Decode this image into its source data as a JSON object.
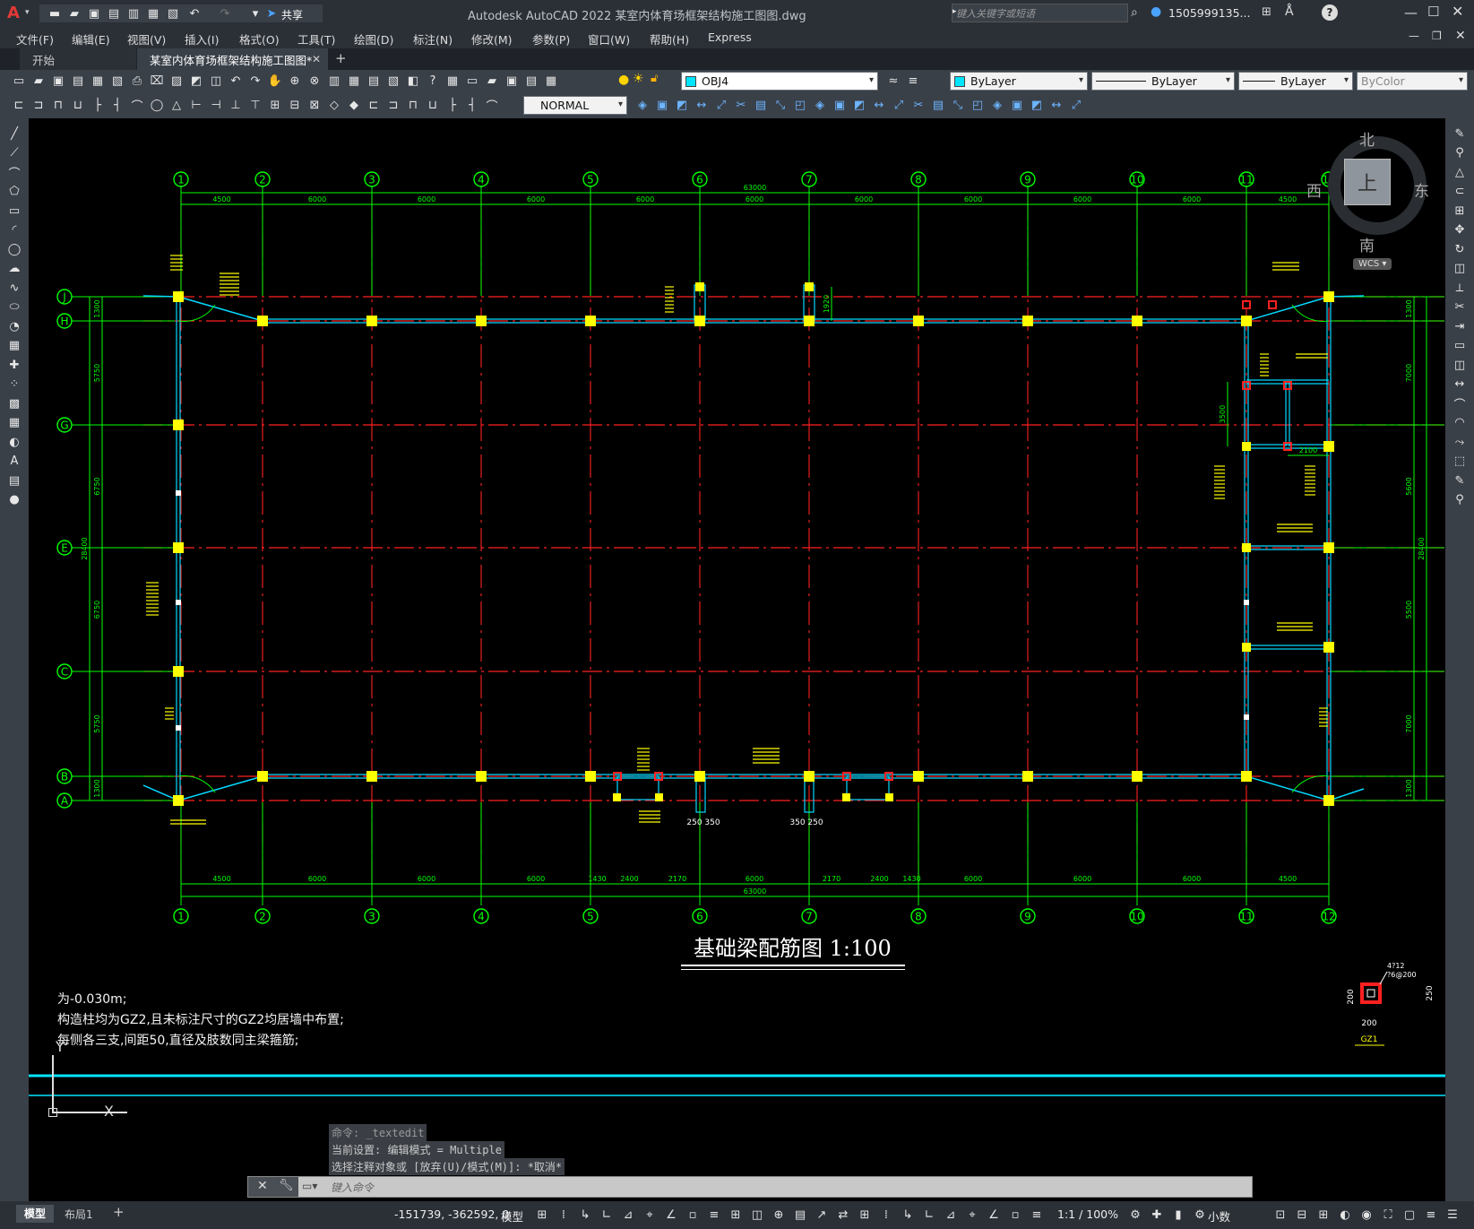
{
  "titlebar": {
    "app_letter": "A",
    "share": "共享",
    "title": "Autodesk AutoCAD 2022    某室内体育场框架结构施工图图.dwg",
    "search_placeholder": "键入关键字或短语",
    "user": "1505999135...",
    "help": "?"
  },
  "menu": [
    "文件(F)",
    "编辑(E)",
    "视图(V)",
    "插入(I)",
    "格式(O)",
    "工具(T)",
    "绘图(D)",
    "标注(N)",
    "修改(M)",
    "参数(P)",
    "窗口(W)",
    "帮助(H)",
    "Express"
  ],
  "tabs": {
    "start": "开始",
    "active": "某室内体育场框架结构施工图图*",
    "add": "+"
  },
  "toolbar": {
    "layer": "OBJ4",
    "color": "ByLayer",
    "linetype": "ByLayer",
    "lineweight": "ByLayer",
    "plotstyle": "ByColor",
    "dimstyle": "NORMAL"
  },
  "viewcube": {
    "north": "北",
    "south": "南",
    "east": "东",
    "west": "西",
    "top": "上",
    "wcs": "WCS"
  },
  "drawing": {
    "title": "基础梁配筋图  1:100",
    "grid_cols": [
      "1",
      "2",
      "3",
      "4",
      "5",
      "6",
      "7",
      "8",
      "9",
      "10",
      "11",
      "12"
    ],
    "grid_rows": [
      "J",
      "H",
      "G",
      "E",
      "C",
      "B",
      "A"
    ],
    "top_dims": [
      "4500",
      "6000",
      "6000",
      "6000",
      "6000",
      "6000",
      "6000",
      "6000",
      "6000",
      "6000",
      "4500"
    ],
    "total_dim": "63000",
    "bottom_dims": [
      "4500",
      "6000",
      "6000",
      "6000",
      "1430",
      "2400",
      "2170",
      "6000",
      "2170",
      "2400",
      "1430",
      "6000",
      "6000",
      "6000",
      "4500"
    ],
    "left_dims": [
      "1300",
      "5750",
      "6750",
      "6750",
      "5750",
      "1300"
    ],
    "right_dims": [
      "1300",
      "7000",
      "5600",
      "5500",
      "7000",
      "1300"
    ],
    "side_total": "28400",
    "notes": [
      "为-0.030m;",
      "构造柱均为GZ2,且未标注尺寸的GZ2均居墙中布置;",
      "每侧各三支,间距50,直径及肢数同主梁箍筋;"
    ],
    "gz1": {
      "label": "GZ1",
      "dim": "200",
      "rebar": "4?12",
      "hoop": "?6@200"
    },
    "misc_dims": [
      "1920",
      "2100",
      "3500",
      "250",
      "350"
    ]
  },
  "command": {
    "history": [
      "命令: _textedit",
      "当前设置: 编辑模式 = Multiple",
      "选择注释对象或 [放弃(U)/模式(M)]: *取消*"
    ],
    "placeholder": "键入命令",
    "axis_x": "X",
    "axis_y": "Y"
  },
  "status": {
    "model_tab": "模型",
    "layout_tab": "布局1",
    "add": "+",
    "coords": "-151739, -362592, 0",
    "model": "模型",
    "scale": "1:1 / 100%",
    "units": "小数"
  }
}
